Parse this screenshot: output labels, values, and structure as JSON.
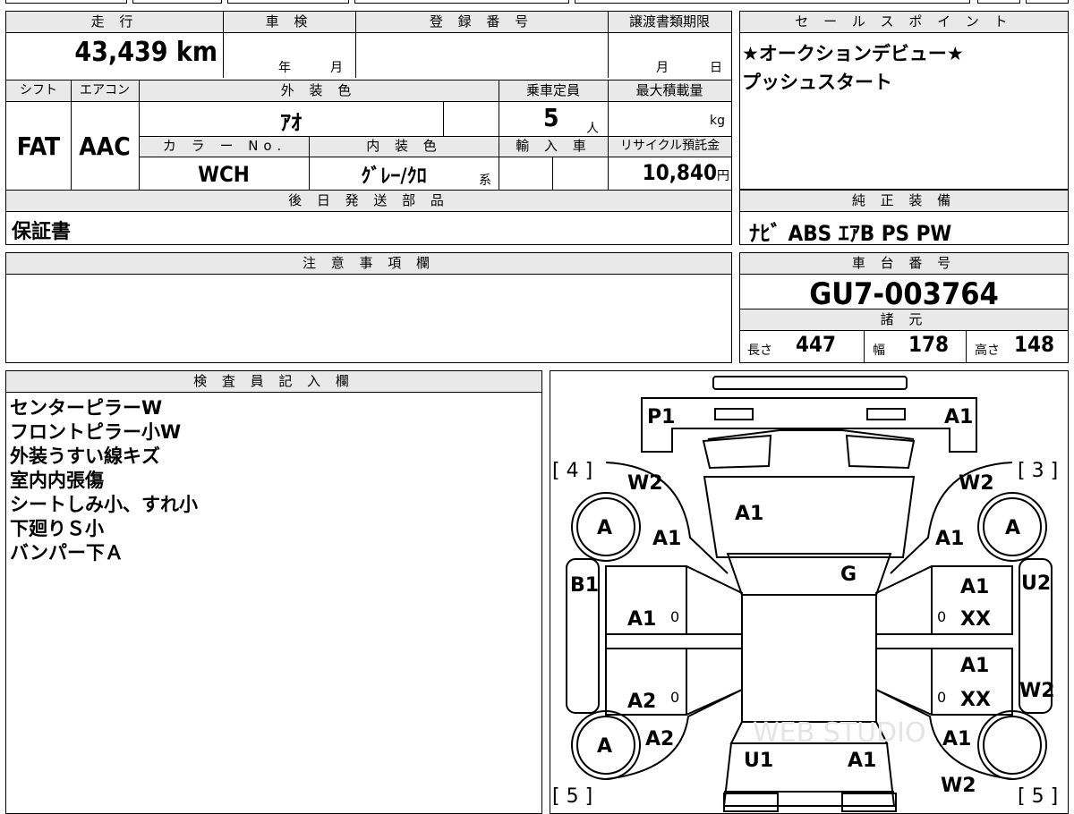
{
  "summary": {
    "mileage_label": "走 行",
    "mileage_value": "43,439",
    "mileage_unit": "km",
    "inspection_label": "車 検",
    "inspection_year": "年",
    "inspection_month": "月",
    "registration_label": "登 録 番 号",
    "transfer_label": "譲渡書類期限",
    "transfer_month": "月",
    "transfer_day": "日",
    "shift_label": "シフト",
    "shift_value": "FAT",
    "aircon_label": "エアコン",
    "aircon_value": "AAC",
    "exterior_label": "外 装 色",
    "exterior_value": "ｱｵ",
    "capacity_label": "乗車定員",
    "capacity_value": "5",
    "capacity_unit": "人",
    "maxload_label": "最大積載量",
    "maxload_unit": "kg",
    "color_no_label": "カ ラ ー No.",
    "color_no_value": "WCH",
    "interior_label": "内 装 色",
    "interior_value": "ｸﾞﾚｰ/ｸﾛ",
    "interior_suffix": "系",
    "import_label": "輸 入 車",
    "recycle_label": "リサイクル預託金",
    "recycle_value": "10,840",
    "recycle_unit": "円",
    "later_label": "後 日 発 送 部 品",
    "later_value": "保証書"
  },
  "sales": {
    "label": "セ ー ル ス ポ イ ン ト",
    "lines": [
      "★オークションデビュー★",
      "プッシュスタート"
    ]
  },
  "equipment": {
    "label": "純 正 装 備",
    "value": "ﾅﾋﾞ ABS ｴｱB PS PW"
  },
  "caution": {
    "label": "注 意 事 項 欄"
  },
  "chassis": {
    "label": "車 台 番 号",
    "value": "GU7-003764",
    "spec_label": "諸 元",
    "length_label": "長さ",
    "length_value": "447",
    "width_label": "幅",
    "width_value": "178",
    "height_label": "高さ",
    "height_value": "148"
  },
  "inspector": {
    "label": "検 査 員 記 入 欄",
    "notes": [
      "センターピラーW",
      "フロントピラー小W",
      "外装うすい線キズ",
      "室内内張傷",
      "シートしみ小、すれ小",
      "下廻りＳ小",
      "バンパー下Ａ"
    ]
  },
  "diagram": {
    "labels": {
      "p1": "P1",
      "a1_front_right": "A1",
      "br4": "[ 4 ]",
      "br3": "[ 3 ]",
      "br5l": "[ 5 ]",
      "br5r": "[ 5 ]",
      "w2_fl": "W2",
      "w2_fr": "W2",
      "a1_hood": "A1",
      "tire_fl": "A",
      "tire_fr": "A",
      "tire_rl": "A",
      "a1_fender_l": "A1",
      "a1_fender_r": "A1",
      "g_glass": "G",
      "b1": "B1",
      "u2": "U2",
      "a1_door_fl": "A1",
      "zero_fl": "0",
      "a1_door_fr": "A1",
      "zero_fr": "0",
      "xx_fr": "XX",
      "a1_door_rr": "A1",
      "zero_rr": "0",
      "xx_rr": "XX",
      "a2_door_rl": "A2",
      "zero_rl": "0",
      "w2_r": "W2",
      "a2_qtr_l": "A2",
      "a1_qtr_r": "A1",
      "u1": "U1",
      "a1_rear": "A1",
      "w2_rr": "W2",
      "watermark": "WEB STUDIO"
    }
  }
}
